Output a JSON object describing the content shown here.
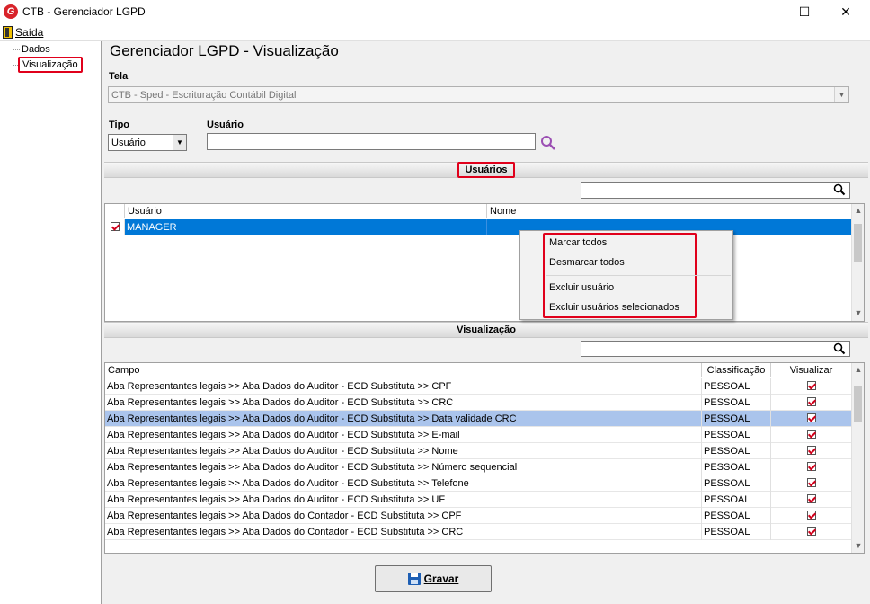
{
  "window": {
    "title": "CTB - Gerenciador LGPD",
    "app_icon": "G",
    "controls": {
      "minimize": "—",
      "maximize": "☐",
      "close": "✕"
    }
  },
  "menubar": {
    "items": [
      {
        "label": "Saída",
        "icon": "exit-door-icon"
      }
    ]
  },
  "sidebar": {
    "items": [
      {
        "label": "Dados"
      },
      {
        "label": "Visualização"
      }
    ]
  },
  "main": {
    "title": "Gerenciador LGPD - Visualização",
    "tela": {
      "label": "Tela",
      "value": "CTB - Sped - Escrituração Contábil Digital"
    },
    "tipo": {
      "label": "Tipo",
      "value": "Usuário"
    },
    "usuario": {
      "label": "Usuário",
      "value": ""
    }
  },
  "usuarios_section": {
    "title": "Usuários",
    "columns": [
      "Usuário",
      "Nome"
    ],
    "rows": [
      {
        "usuario": "MANAGER",
        "nome": "",
        "checked": true
      }
    ]
  },
  "context_menu": {
    "items": [
      "Marcar todos",
      "Desmarcar todos",
      "Excluir usuário",
      "Excluir usuários selecionados"
    ]
  },
  "visualizacao_section": {
    "title": "Visualização",
    "columns": [
      "Campo",
      "Classificação",
      "Visualizar"
    ],
    "rows": [
      {
        "campo": "Aba Representantes legais >> Aba Dados do Auditor - ECD Substituta >> CPF",
        "classificacao": "PESSOAL",
        "visualizar": true
      },
      {
        "campo": "Aba Representantes legais >> Aba Dados do Auditor - ECD Substituta >> CRC",
        "classificacao": "PESSOAL",
        "visualizar": true
      },
      {
        "campo": "Aba Representantes legais >> Aba Dados do Auditor - ECD Substituta >> Data validade CRC",
        "classificacao": "PESSOAL",
        "visualizar": true,
        "selected": true
      },
      {
        "campo": "Aba Representantes legais >> Aba Dados do Auditor - ECD Substituta >> E-mail",
        "classificacao": "PESSOAL",
        "visualizar": true
      },
      {
        "campo": "Aba Representantes legais >> Aba Dados do Auditor - ECD Substituta >> Nome",
        "classificacao": "PESSOAL",
        "visualizar": true
      },
      {
        "campo": "Aba Representantes legais >> Aba Dados do Auditor - ECD Substituta >> Número sequencial",
        "classificacao": "PESSOAL",
        "visualizar": true
      },
      {
        "campo": "Aba Representantes legais >> Aba Dados do Auditor - ECD Substituta >> Telefone",
        "classificacao": "PESSOAL",
        "visualizar": true
      },
      {
        "campo": "Aba Representantes legais >> Aba Dados do Auditor - ECD Substituta >> UF",
        "classificacao": "PESSOAL",
        "visualizar": true
      },
      {
        "campo": "Aba Representantes legais >> Aba Dados do Contador - ECD Substituta >> CPF",
        "classificacao": "PESSOAL",
        "visualizar": true
      },
      {
        "campo": "Aba Representantes legais >> Aba Dados do Contador - ECD Substituta >> CRC",
        "classificacao": "PESSOAL",
        "visualizar": true
      }
    ]
  },
  "footer": {
    "save_label": "Gravar"
  },
  "colors": {
    "selection": "#0078d7",
    "row_highlight": "#aac4ec",
    "annotation_red": "#e0001b",
    "check_red": "#d0001b"
  }
}
